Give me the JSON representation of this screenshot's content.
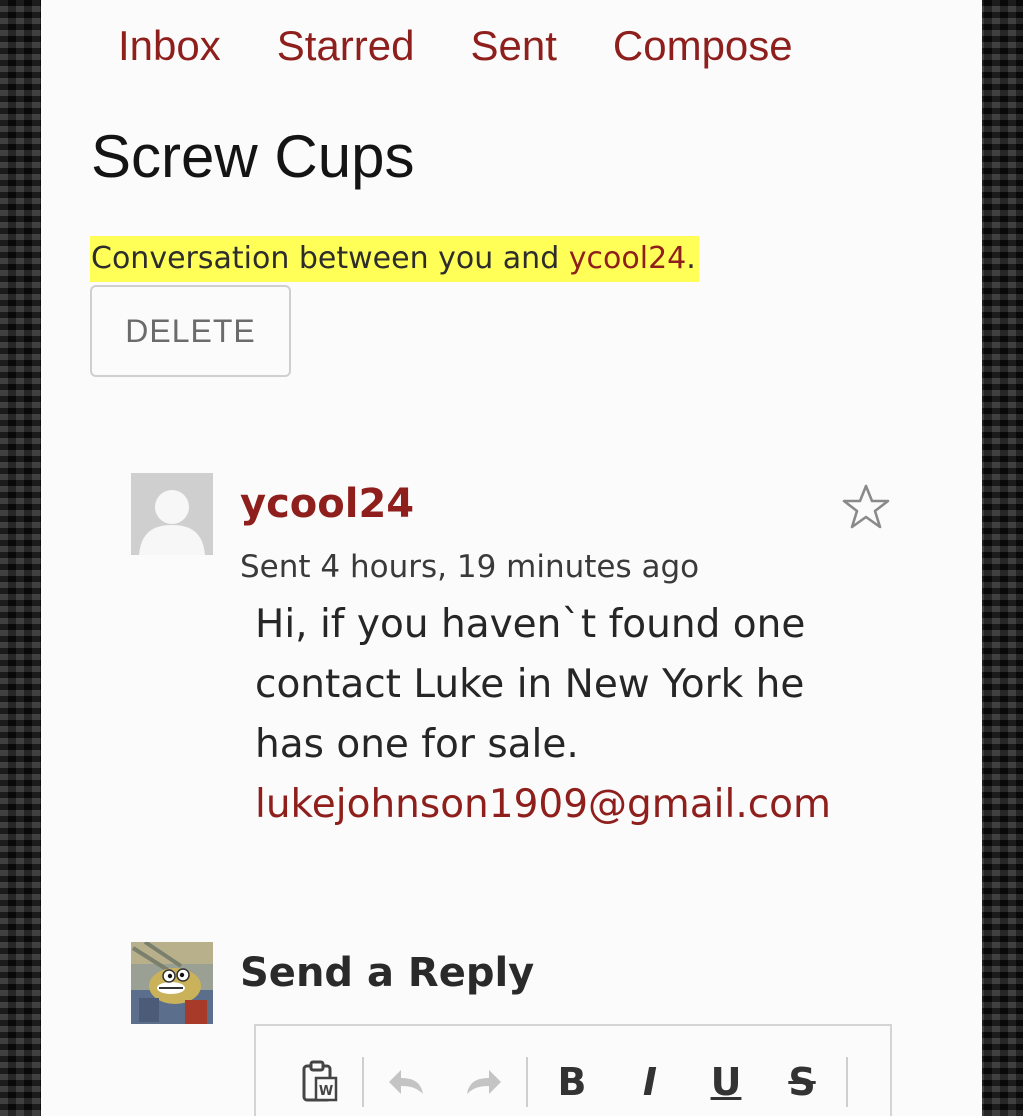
{
  "nav": {
    "items": [
      "Inbox",
      "Starred",
      "Sent",
      "Compose"
    ]
  },
  "thread": {
    "title": "Screw Cups",
    "conversation_prefix": "Conversation between you and ",
    "conversation_user": "ycool24",
    "conversation_suffix": ".",
    "delete_label": "DELETE"
  },
  "message": {
    "sender": "ycool24",
    "sent_time": "Sent 4 hours, 19 minutes ago",
    "body_lines": [
      "Hi, if you haven`t found one",
      "contact Luke in New York he",
      "has one for sale."
    ],
    "email": "lukejohnson1909@gmail.com",
    "starred": false
  },
  "reply": {
    "title": "Send a Reply"
  },
  "toolbar": {
    "bold": "B",
    "italic": "I",
    "underline": "U",
    "strike": "S",
    "icons": [
      "paste-word-icon",
      "undo-icon",
      "redo-icon"
    ]
  },
  "colors": {
    "accent": "#8e1f1c",
    "highlight": "#ffff57",
    "page": "#fbfbfb"
  }
}
